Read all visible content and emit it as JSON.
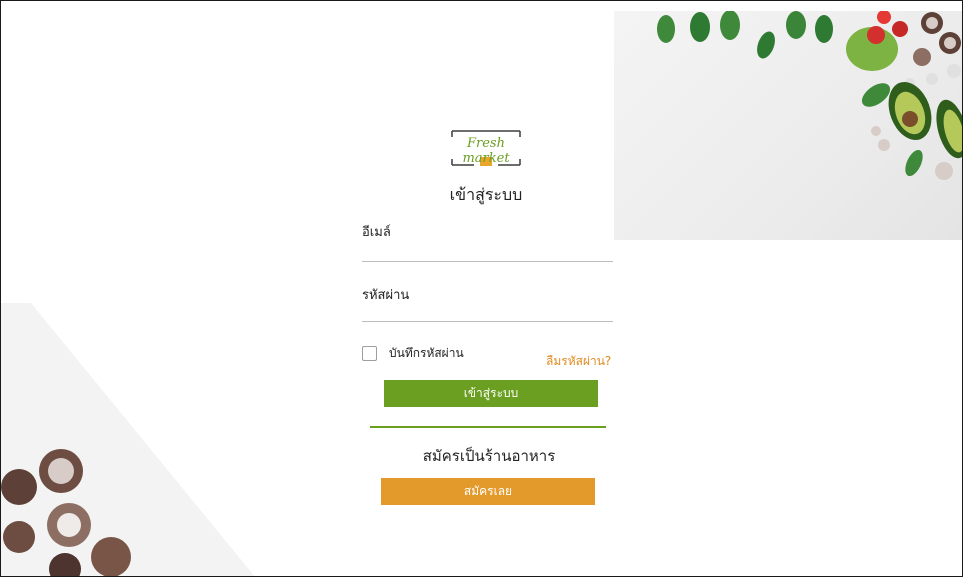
{
  "logo": {
    "text": "Fresh market",
    "icon": "market-basket-icon"
  },
  "login": {
    "title": "เข้าสู่ระบบ",
    "email_label": "อีเมล์",
    "email_value": "",
    "password_label": "รหัสผ่าน",
    "password_value": "",
    "remember_label": "บันทึกรหัสผ่าน",
    "remember_checked": false,
    "forgot_label": "ลืมรหัสผ่าน?",
    "submit_label": "เข้าสู่ระบบ"
  },
  "register": {
    "title": "สมัครเป็นร้านอาหาร",
    "button_label": "สมัครเลย"
  },
  "colors": {
    "primary_green": "#6a9f22",
    "accent_orange": "#e49a2b",
    "link_orange": "#e08a1e"
  }
}
